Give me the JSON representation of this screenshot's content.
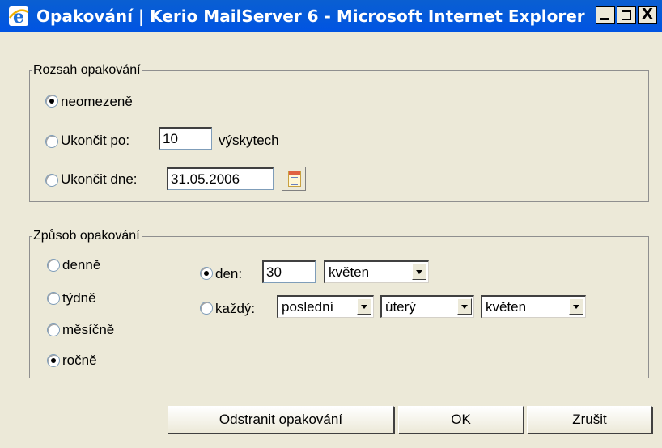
{
  "window": {
    "title": "Opakování | Kerio MailServer 6 - Microsoft Internet Explorer",
    "close_glyph": "X"
  },
  "range": {
    "legend": "Rozsah opakování",
    "unlimited_label": "neomezeně",
    "end_after_label": "Ukončit po:",
    "end_after_value": "10",
    "occurrences_label": "výskytech",
    "end_on_label": "Ukončit dne:",
    "end_on_value": "31.05.2006",
    "selected": "unlimited"
  },
  "pattern": {
    "legend": "Způsob opakování",
    "daily_label": "denně",
    "weekly_label": "týdně",
    "monthly_label": "měsíčně",
    "yearly_label": "ročně",
    "selected": "yearly",
    "day_label": "den:",
    "day_value": "30",
    "day_month": "květen",
    "every_label": "každý:",
    "every_which": "poslední",
    "every_weekday": "úterý",
    "every_month": "květen",
    "sub_selected": "day"
  },
  "buttons": {
    "remove": "Odstranit opakování",
    "ok": "OK",
    "cancel": "Zrušit"
  },
  "icons": {
    "title": "ie-icon",
    "calendar": "calendar-icon"
  }
}
